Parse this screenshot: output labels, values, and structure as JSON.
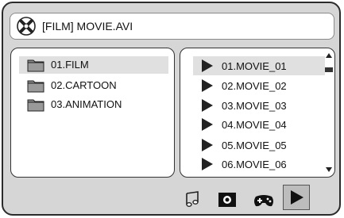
{
  "header": {
    "title": "[FILM] MOVIE.AVI",
    "icon": "disc-icon"
  },
  "folders": [
    {
      "label": "01.FILM",
      "selected": true
    },
    {
      "label": "02.CARTOON",
      "selected": false
    },
    {
      "label": "03.ANIMATION",
      "selected": false
    }
  ],
  "files": [
    {
      "label": "01.MOVIE_01",
      "selected": true
    },
    {
      "label": "02.MOVIE_02",
      "selected": false
    },
    {
      "label": "03.MOVIE_03",
      "selected": false
    },
    {
      "label": "04.MOVIE_04",
      "selected": false
    },
    {
      "label": "05.MOVIE_05",
      "selected": false
    },
    {
      "label": "06.MOVIE_06",
      "selected": false
    }
  ],
  "toolbar": {
    "icons": [
      "music-icon",
      "photo-icon",
      "game-icon",
      "video-play-icon"
    ],
    "active": "video-play-icon"
  },
  "colors": {
    "background": "#d6d6d6",
    "panel": "#ffffff",
    "selection": "#e0e0e0",
    "border": "#2b2b2b"
  }
}
